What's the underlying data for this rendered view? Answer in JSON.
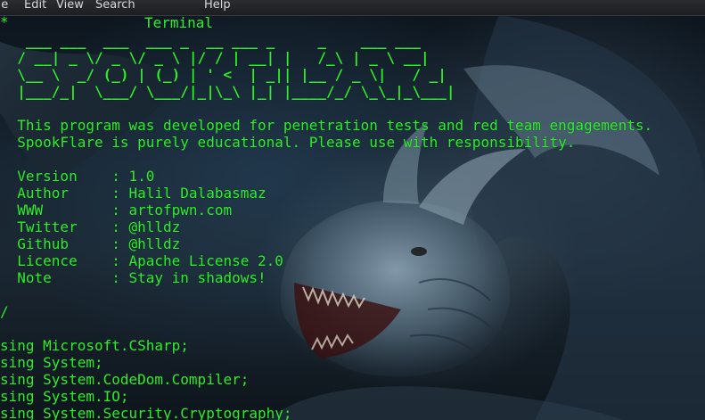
{
  "menu": {
    "file": "ile",
    "edit": "Edit",
    "view": "View",
    "search": "Search",
    "terminal": "Terminal",
    "help": "Help"
  },
  "terminal": {
    "comment_open": "*",
    "banner": [
      "   ___ ___  ___  ___ _  __ ___ _     _    ___ ___",
      "  / __| _ \\/ _ \\/ _ \\ |/ / | __| |   /_\\ | _ \\ __|",
      "  \\__ \\  _/ (_) | (_) | ' <  | _|| |__ / _ \\|   / _|",
      "  |___/_|  \\___/ \\___/|_|\\_\\ |_| |____/_/ \\_\\_|_\\___|"
    ],
    "description": [
      "  This program was developed for penetration tests and red team engagements.",
      "  SpookFlare is purely educational. Please use with responsibility."
    ],
    "info": [
      "  Version    : 1.0",
      "  Author     : Halil Dalabasmaz",
      "  WWW        : artofpwn.com",
      "  Twitter    : @hlldz",
      "  Github     : @hlldz",
      "  Licence    : Apache License 2.0",
      "  Note       : Stay in shadows!"
    ],
    "comment_close": "/",
    "usings": [
      "sing Microsoft.CSharp;",
      "sing System;",
      "sing System.CodeDom.Compiler;",
      "sing System.IO;",
      "sing System.Security.Cryptography;"
    ]
  },
  "colors": {
    "terminal_text": "#2cf02c",
    "menubar_bg": "#1e2023",
    "menubar_text": "#d8d8d8"
  },
  "background_image": "dragon-head-icon"
}
